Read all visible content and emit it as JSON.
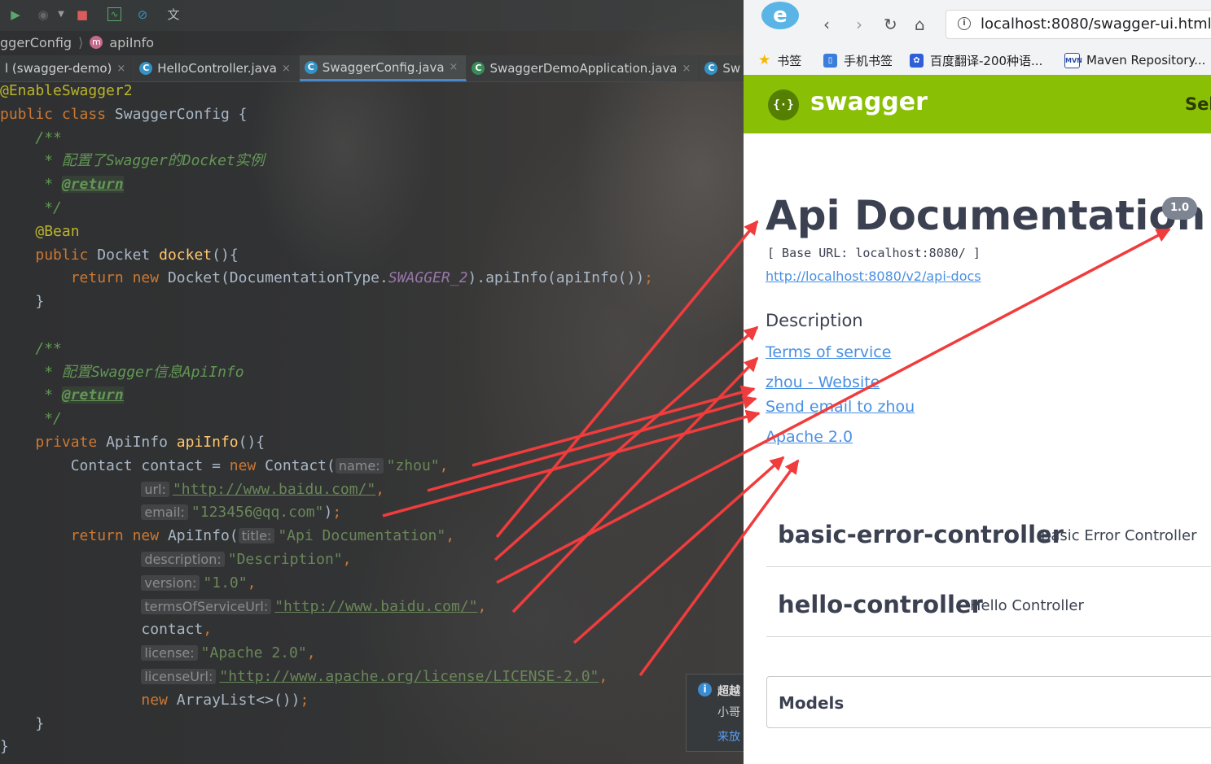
{
  "ide": {
    "breadcrumb": {
      "class_name": "ggerConfig",
      "method_icon": "m",
      "method_name": "apiInfo"
    },
    "tabs": [
      {
        "label": "l (swagger-demo)",
        "icon": "",
        "active": false
      },
      {
        "label": "HelloController.java",
        "icon": "C",
        "active": false
      },
      {
        "label": "SwaggerConfig.java",
        "icon": "C",
        "active": true
      },
      {
        "label": "SwaggerDemoApplication.java",
        "icon": "C",
        "active": false
      },
      {
        "label": "Sw",
        "icon": "C",
        "active": false
      }
    ],
    "close_glyph": "×",
    "code": {
      "l1": {
        "annotation": "@EnableSwagger2"
      },
      "l2": {
        "kw1": "public",
        "kw2": "class",
        "name": "SwaggerConfig",
        "brace": "{"
      },
      "l3": {
        "comment": "/**"
      },
      "l4": {
        "comment": " * 配置了Swagger的Docket实例"
      },
      "l5": {
        "star": " * ",
        "tag": "@return"
      },
      "l6": {
        "comment": " */"
      },
      "l7": {
        "annotation": "@Bean"
      },
      "l8": {
        "kw": "public",
        "type": "Docket",
        "fn": "docket",
        "rest": "(){"
      },
      "l9": {
        "kw1": "return",
        "kw2": "new",
        "call": "Docket(DocumentationType.",
        "static": "SWAGGER_2",
        "rest": ").apiInfo(apiInfo())",
        "semi": ";"
      },
      "l10": {
        "brace": "}"
      },
      "l12": {
        "comment": "/**"
      },
      "l13": {
        "comment": " * 配置Swagger信息ApiInfo"
      },
      "l14": {
        "star": " * ",
        "tag": "@return"
      },
      "l15": {
        "comment": " */"
      },
      "l16": {
        "kw": "private",
        "type": "ApiInfo",
        "fn": "apiInfo",
        "rest": "(){"
      },
      "l17": {
        "decl": "Contact contact = ",
        "kw": "new",
        "call": "Contact(",
        "hint": "name:",
        "str": "\"zhou\"",
        "comma": ","
      },
      "l18": {
        "hint": "url:",
        "str": "\"http://www.baidu.com/\"",
        "comma": ","
      },
      "l19": {
        "hint": "email:",
        "str": "\"123456@qq.com\"",
        "rest": ")",
        "semi": ";"
      },
      "l20": {
        "kw1": "return",
        "kw2": "new",
        "call": "ApiInfo(",
        "hint": "title:",
        "str": "\"Api Documentation\"",
        "comma": ","
      },
      "l21": {
        "hint": "description:",
        "str": "\"Description\"",
        "comma": ","
      },
      "l22": {
        "hint": "version:",
        "str": "\"1.0\"",
        "comma": ","
      },
      "l23": {
        "hint": "termsOfServiceUrl:",
        "str": "\"http://www.baidu.com/\"",
        "comma": ","
      },
      "l24": {
        "text": "contact",
        "comma": ","
      },
      "l25": {
        "hint": "license:",
        "str": "\"Apache 2.0\"",
        "comma": ","
      },
      "l26": {
        "hint": "licenseUrl:",
        "str": "\"http://www.apache.org/license/LICENSE-2.0\"",
        "comma": ","
      },
      "l27": {
        "kw": "new",
        "rest": "ArrayList<>())",
        "semi": ";"
      },
      "l28": {
        "brace": "}"
      },
      "l29": {
        "brace": "}"
      }
    },
    "notification": {
      "line1": "超越",
      "line2": "小哥",
      "line3": "来放"
    }
  },
  "browser": {
    "url": "localhost:8080/swagger-ui.html",
    "bookmarks": [
      "书签",
      "手机书签",
      "百度翻译-200种语...",
      "Maven Repository..."
    ],
    "swagger_brand": "swagger",
    "header_select": "Sel",
    "api": {
      "title": "Api Documentation",
      "version": "1.0",
      "base_url": "[ Base URL: localhost:8080/ ]",
      "docs_link": "http://localhost:8080/v2/api-docs",
      "description": "Description",
      "terms_link": "Terms of service",
      "website_link": "zhou - Website",
      "email_link": "Send email to zhou",
      "license_link": "Apache 2.0"
    },
    "controllers": [
      {
        "name": "basic-error-controller",
        "desc": "Basic Error Controller"
      },
      {
        "name": "hello-controller",
        "desc": "Hello Controller"
      }
    ],
    "models_label": "Models"
  },
  "colors": {
    "arrow": "#f03c3c",
    "swagger_green": "#89bf04",
    "link": "#4990e2"
  }
}
